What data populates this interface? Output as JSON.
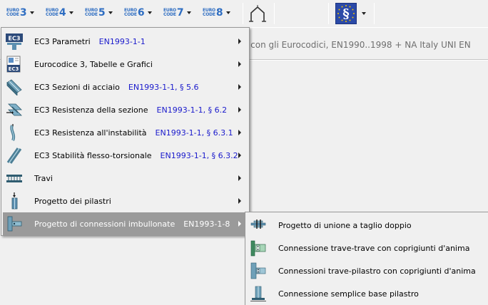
{
  "toolbar": {
    "code_buttons": [
      {
        "euro": "EURO",
        "code": "CODE",
        "num": "3"
      },
      {
        "euro": "EURO",
        "code": "CODE",
        "num": "4"
      },
      {
        "euro": "EURO",
        "code": "CODE",
        "num": "5"
      },
      {
        "euro": "EURO",
        "code": "CODE",
        "num": "6"
      },
      {
        "euro": "EURO",
        "code": "CODE",
        "num": "7"
      },
      {
        "euro": "EURO",
        "code": "CODE",
        "num": "8"
      }
    ],
    "frame_icon": "portal-frame-icon",
    "standards_icon": "eu-paragraph-icon",
    "standards_symbol": "§",
    "accent_color": "#2f6ec2"
  },
  "header": {
    "text": "o con gli Eurocodici,  EN1990..1998 + NA Italy UNI EN"
  },
  "main_menu": {
    "items": [
      {
        "label": "EC3 Parametri",
        "ref": "EN1993-1-1",
        "icon": "ec3-parameters-icon",
        "has_submenu": true
      },
      {
        "label": "Eurocodice 3, Tabelle e Grafici",
        "ref": "",
        "icon": "ec3-tables-icon",
        "has_submenu": true
      },
      {
        "label": "EC3 Sezioni di acciaio",
        "ref": "EN1993-1-1, § 5.6",
        "icon": "steel-section-icon",
        "has_submenu": true
      },
      {
        "label": "EC3 Resistenza della sezione",
        "ref": "EN1993-1-1, § 6.2",
        "icon": "section-resistance-icon",
        "has_submenu": true
      },
      {
        "label": "EC3 Resistenza all'instabilità",
        "ref": "EN1993-1-1, § 6.3.1",
        "icon": "buckling-resistance-icon",
        "has_submenu": true
      },
      {
        "label": "EC3 Stabilità flesso-torsionale",
        "ref": "EN1993-1-1, § 6.3.2",
        "icon": "lateral-torsional-icon",
        "has_submenu": true
      },
      {
        "label": "Travi",
        "ref": "",
        "icon": "beam-icon",
        "has_submenu": true
      },
      {
        "label": "Progetto dei pilastri",
        "ref": "",
        "icon": "column-icon",
        "has_submenu": true
      },
      {
        "label": "Progetto di connessioni imbullonate",
        "ref": "EN1993-1-8",
        "icon": "bolted-connection-icon",
        "has_submenu": true,
        "highlighted": true
      }
    ]
  },
  "sub_menu": {
    "items": [
      {
        "label": "Progetto di unione a taglio doppio",
        "icon": "double-shear-joint-icon"
      },
      {
        "label": "Connessione trave-trave con coprigiunti d'anima",
        "icon": "beam-beam-connection-icon"
      },
      {
        "label": "Connessioni trave-pilastro con coprigiunti d'anima",
        "icon": "beam-column-connection-icon"
      },
      {
        "label": "Connessione semplice base pilastro",
        "icon": "column-base-icon"
      }
    ]
  }
}
